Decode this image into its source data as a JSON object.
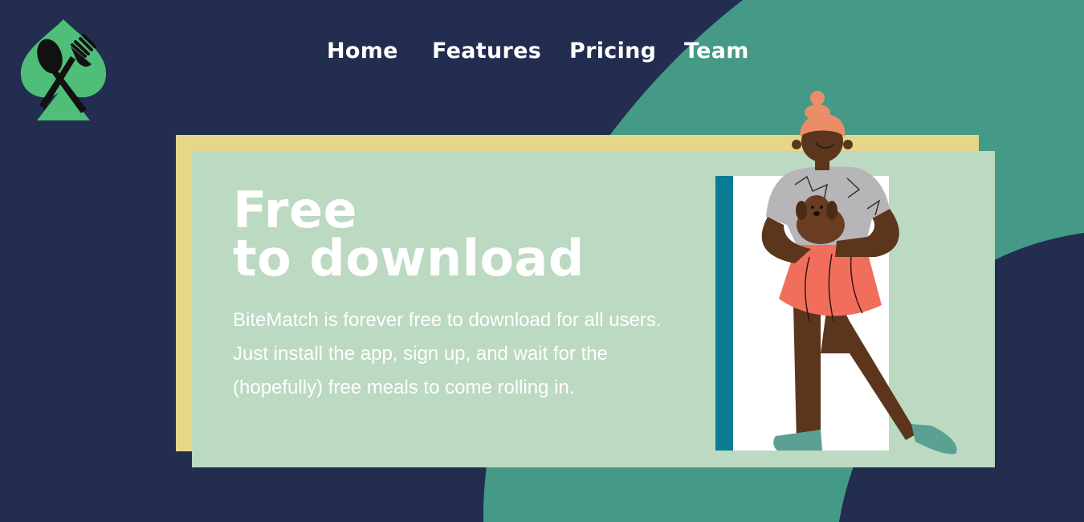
{
  "brand": {
    "logo_icon": "spade-fork-spoon-icon",
    "logo_color": "#4fbe79"
  },
  "nav": {
    "links": [
      {
        "label": "Home"
      },
      {
        "label": "Features"
      },
      {
        "label": "Pricing"
      },
      {
        "label": "Team"
      }
    ]
  },
  "hero": {
    "title_line1": "Free",
    "title_line2": "to download",
    "description": "BiteMatch is forever free to download for all users. Just install the app, sign up, and wait for the (hopefully) free meals to come rolling in.",
    "illustration": "woman-holding-puppy-illustration"
  },
  "colors": {
    "background": "#222d50",
    "accent_green": "#449a86",
    "card_green": "#bcd9c1",
    "card_yellow": "#e6d688",
    "text": "#ffffff"
  }
}
